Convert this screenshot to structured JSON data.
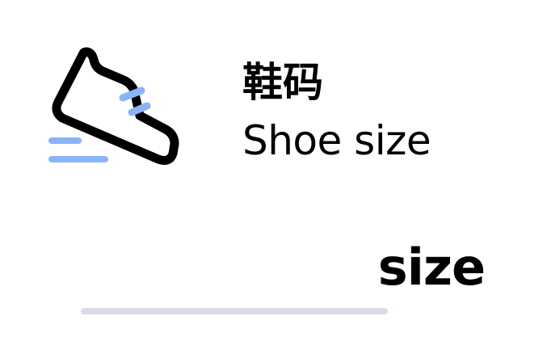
{
  "header": {
    "title_cn": "鞋码",
    "title_en": "Shoe size",
    "icon": "sneaker-icon"
  },
  "field": {
    "value": "size"
  },
  "colors": {
    "icon_stroke": "#000000",
    "accent": "#8ab4f8",
    "track": "#d9dbe6"
  }
}
